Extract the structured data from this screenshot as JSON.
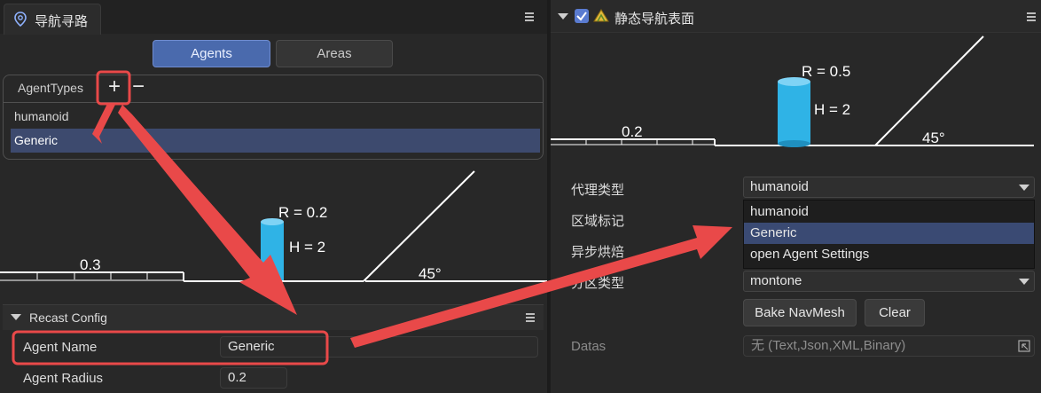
{
  "left_panel": {
    "title": "导航寻路",
    "tabs": [
      {
        "label": "Agents",
        "active": true
      },
      {
        "label": "Areas",
        "active": false
      }
    ],
    "agent_types": {
      "label": "AgentTypes",
      "add_symbol": "+",
      "remove_symbol": "−",
      "items": [
        "humanoid",
        "Generic"
      ],
      "selected_index": 1
    },
    "diagram": {
      "radius_label": "R = 0.2",
      "height_label": "H = 2",
      "step_label": "0.3",
      "slope_label": "45°"
    },
    "recast_config": {
      "title": "Recast Config",
      "agent_name_label": "Agent Name",
      "agent_name_value": "Generic",
      "agent_radius_label": "Agent Radius",
      "agent_radius_value": "0.2"
    }
  },
  "right_panel": {
    "title": "静态导航表面",
    "enabled": true,
    "diagram": {
      "radius_label": "R = 0.5",
      "height_label": "H = 2",
      "step_label": "0.2",
      "slope_label": "45°"
    },
    "properties": {
      "agent_type_label": "代理类型",
      "agent_type_value": "humanoid",
      "area_label": "区域标记",
      "async_bake_label": "异步烘焙",
      "partition_label": "分区类型",
      "partition_value": "montone",
      "datas_label": "Datas",
      "datas_placeholder": "无 (Text,Json,XML,Binary)"
    },
    "dropdown_options": [
      "humanoid",
      "Generic",
      "open Agent Settings"
    ],
    "dropdown_selected_index": 1,
    "buttons": {
      "bake": "Bake NavMesh",
      "clear": "Clear"
    }
  },
  "colors": {
    "accent": "#4a6aad",
    "selection": "#3d4a6e",
    "annotation": "#e94949",
    "cylinder": "#2fb3e6"
  }
}
